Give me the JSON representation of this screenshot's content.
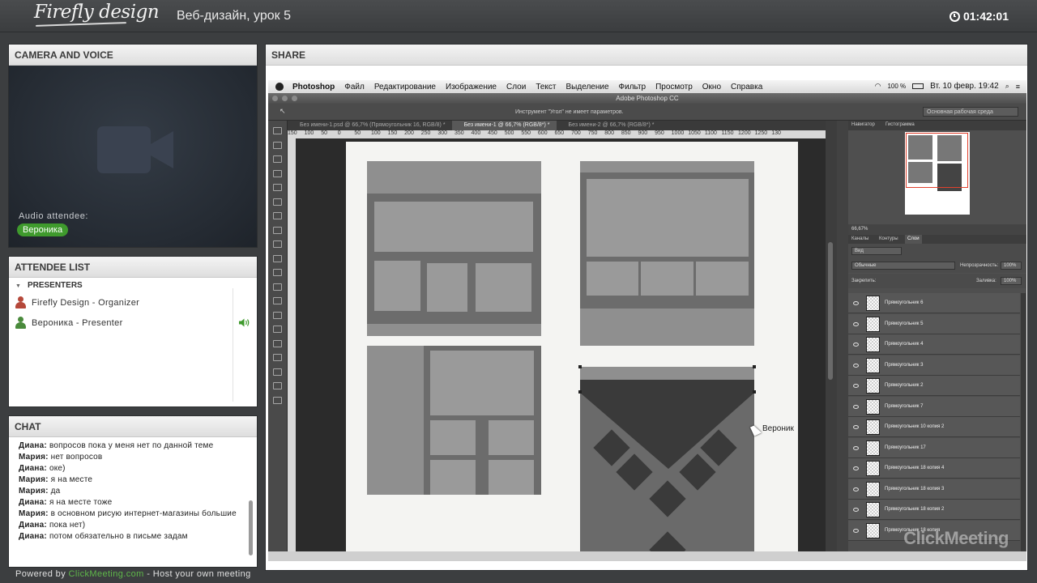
{
  "header": {
    "logo": "Firefly design",
    "title": "Веб-дизайн, урок 5",
    "timer": "01:42:01"
  },
  "camera": {
    "title": "CAMERA AND VOICE",
    "audio_label": "Audio attendee:",
    "audio_name": "Вероника"
  },
  "attendees": {
    "title": "ATTENDEE LIST",
    "group": "PRESENTERS",
    "items": [
      {
        "name": "Firefly Design - Organizer",
        "color": "#b5483a"
      },
      {
        "name": "Вероника - Presenter",
        "color": "#4a8a3c"
      }
    ]
  },
  "chat": {
    "title": "CHAT",
    "messages": [
      {
        "author": "Диана:",
        "text": "вопросов пока у меня нет по данной теме"
      },
      {
        "author": "Мария:",
        "text": "нет вопросов"
      },
      {
        "author": "Диана:",
        "text": "оке)"
      },
      {
        "author": "Мария:",
        "text": "я на месте"
      },
      {
        "author": "Мария:",
        "text": "да"
      },
      {
        "author": "Диана:",
        "text": "я на месте тоже"
      },
      {
        "author": "Мария:",
        "text": "в основном рисую интернет-магазины большие"
      },
      {
        "author": "Диана:",
        "text": "пока нет)"
      },
      {
        "author": "Диана:",
        "text": "потом обязательно в письме задам"
      }
    ]
  },
  "footer": {
    "prefix": "Powered by ",
    "link": "ClickMeeting.com",
    "suffix": " - Host your own meeting"
  },
  "share": {
    "title": "SHARE",
    "mac_menu": [
      "Photoshop",
      "Файл",
      "Редактирование",
      "Изображение",
      "Слои",
      "Текст",
      "Выделение",
      "Фильтр",
      "Просмотр",
      "Окно",
      "Справка"
    ],
    "mac_status": {
      "battery": "100 %",
      "datetime": "Вт. 10 февр.  19:42"
    },
    "window_title": "Adobe Photoshop CC",
    "options_hint": "Инструмент \"Угол\" не имеет параметров.",
    "workspace": "Основная рабочая среда",
    "doc_tabs": [
      "Без имени-1.psd @ 66,7% (Прямоугольник 16, RGB/8) *",
      "Без имени-1 @ 66,7% (RGB/8*) *",
      "Без имени-2 @ 66,7% (RGB/8*) *"
    ],
    "ruler": [
      "150",
      "100",
      "50",
      "0",
      "50",
      "100",
      "150",
      "200",
      "250",
      "300",
      "350",
      "400",
      "450",
      "500",
      "550",
      "600",
      "650",
      "700",
      "750",
      "800",
      "850",
      "900",
      "950",
      "1000",
      "1050",
      "1100",
      "1150",
      "1200",
      "1250",
      "130"
    ],
    "navigator_tabs": [
      "Навигатор",
      "Гистограмма"
    ],
    "zoom": "66,67%",
    "layers_tabs": [
      "Каналы",
      "Контуры",
      "Слои"
    ],
    "layer_filter": "Вид",
    "blend_mode": "Обычные",
    "opacity_label": "Непрозрачность:",
    "opacity": "100%",
    "lock_label": "Закрепить:",
    "fill_label": "Заливка:",
    "fill": "100%",
    "layers": [
      "Прямоугольник 6",
      "Прямоугольник 5",
      "Прямоугольник 4",
      "Прямоугольник 3",
      "Прямоугольник 2",
      "Прямоугольник 7",
      "Прямоугольник 10 копия 2",
      "Прямоугольник 17",
      "Прямоугольник 18 копия 4",
      "Прямоугольник 18 копия 3",
      "Прямоугольник 18 копия 2",
      "Прямоугольник 18 копия"
    ],
    "cursor_label": "Вероник",
    "watermark": "ClickMeeting"
  }
}
